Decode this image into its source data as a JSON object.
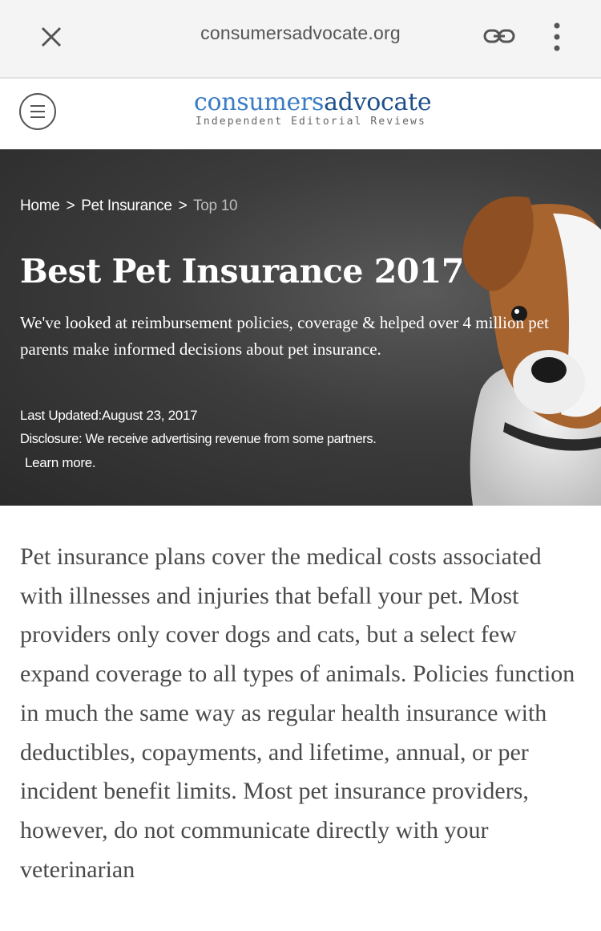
{
  "browser": {
    "url": "consumersadvocate.org",
    "icons": {
      "close": "close-icon",
      "link": "link-icon",
      "more": "more-vert-icon"
    }
  },
  "site": {
    "logo_part1": "consumers",
    "logo_part2": "advocate",
    "tagline": "Independent Editorial Reviews",
    "colors": {
      "logo_light": "#3a7cc4",
      "logo_dark": "#1e4f8a"
    },
    "menu_icon": "hamburger-menu-icon"
  },
  "hero": {
    "breadcrumb": {
      "home": "Home",
      "sep": ">",
      "category": "Pet Insurance",
      "current": "Top 10"
    },
    "title": "Best Pet Insurance 2017",
    "subtitle": "We've looked at reimbursement policies, coverage & helped over 4 million pet parents make informed decisions about pet insurance.",
    "last_updated": "Last Updated:August 23, 2017",
    "disclosure": "Disclosure: We receive advertising revenue from some partners.",
    "learn_more": "Learn more."
  },
  "article": {
    "intro": "Pet insurance plans cover the medical costs associated with illnesses and injuries that befall your pet. Most providers only cover dogs and cats, but a select few expand coverage to all types of animals. Policies function in much the same way as regular health insurance with deductibles, copayments, and lifetime, annual, or per incident benefit limits. Most pet insurance providers, however, do not communicate directly with your veterinarian"
  }
}
